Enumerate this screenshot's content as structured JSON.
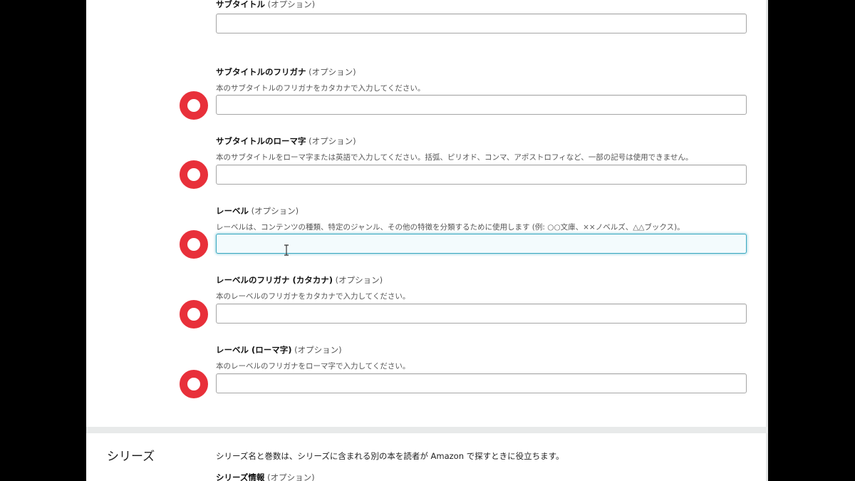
{
  "fields": [
    {
      "label": "サブタイトル",
      "optional": "(オプション)",
      "help": ""
    },
    {
      "label": "サブタイトルのフリガナ",
      "optional": "(オプション)",
      "help": "本のサブタイトルのフリガナをカタカナで入力してください。"
    },
    {
      "label": "サブタイトルのローマ字",
      "optional": "(オプション)",
      "help": "本のサブタイトルをローマ字または英語で入力してください。括弧、ピリオド、コンマ、アポストロフィなど、一部の記号は使用できません。"
    },
    {
      "label": "レーベル",
      "optional": "(オプション)",
      "help": "レーベルは、コンテンツの種類、特定のジャンル、その他の特徴を分類するために使用します (例: ○○文庫、××ノベルズ、△△ブックス)。"
    },
    {
      "label": "レーベルのフリガナ (カタカナ)",
      "optional": "(オプション)",
      "help": "本のレーベルのフリガナをカタカナで入力してください。"
    },
    {
      "label": "レーベル (ローマ字)",
      "optional": "(オプション)",
      "help": "本のレーベルのフリガナをローマ字で入力してください。"
    }
  ],
  "series": {
    "title": "シリーズ",
    "description": "シリーズ名と巻数は、シリーズに含まれる別の本を読者が Amazon で探すときに役立ちます。",
    "info_label": "シリーズ情報",
    "info_optional": "(オプション)"
  },
  "colors": {
    "marker": "#e8303a",
    "focus_border": "#3aa8c0",
    "divider": "#e8eaea"
  }
}
